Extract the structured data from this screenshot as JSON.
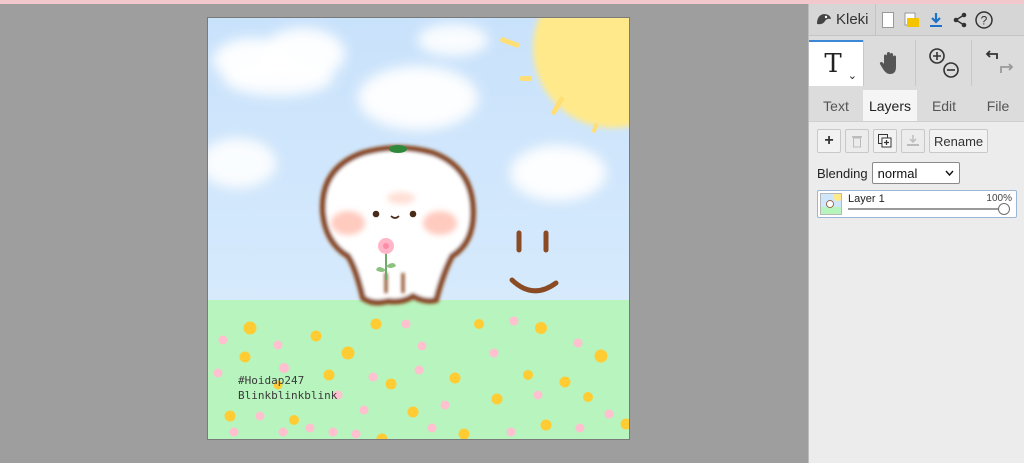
{
  "app": {
    "name": "Kleki",
    "accent_color": "#3c87d6",
    "top_icons": [
      "new-file-icon",
      "open-folder-icon",
      "download-icon",
      "share-icon",
      "help-icon"
    ]
  },
  "toolbar": {
    "active_tool_glyph": "T",
    "active_tool_chevron": "⌄",
    "tools": [
      "text-tool-icon",
      "hand-tool-icon",
      "zoom-in-icon",
      "zoom-out-icon",
      "undo-icon",
      "redo-icon"
    ]
  },
  "tabs": [
    {
      "label": "Text",
      "active": false
    },
    {
      "label": "Layers",
      "active": true
    },
    {
      "label": "Edit",
      "active": false
    },
    {
      "label": "File",
      "active": false
    }
  ],
  "layers_panel": {
    "add_glyph": "+",
    "rename_label": "Rename",
    "blending_label": "Blending",
    "blending_value": "normal",
    "layers": [
      {
        "name": "Layer 1",
        "opacity_text": "100%",
        "opacity": 1.0
      }
    ]
  },
  "canvas": {
    "caption_line1": "#Hoidap247",
    "caption_line2": "Blinkblinkblink"
  }
}
